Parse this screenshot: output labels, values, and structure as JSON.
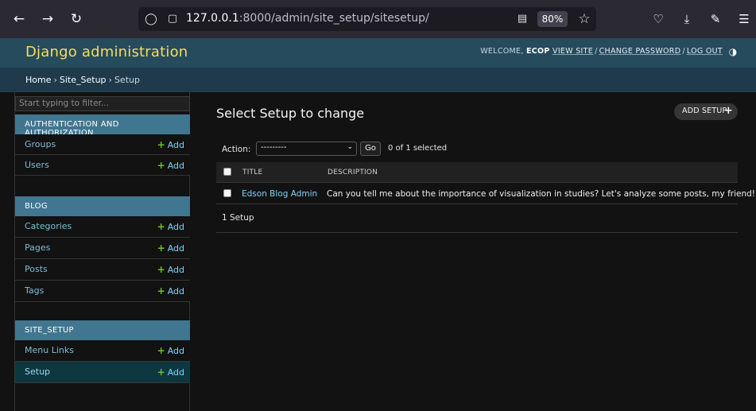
{
  "browser": {
    "url_host": "127.0.0.1",
    "url_rest": ":8000/admin/site_setup/sitesetup/",
    "zoom": "80%"
  },
  "header": {
    "brand": "Django administration",
    "welcome": "Welcome,",
    "username": "ECOP",
    "view_site": "View site",
    "change_password": "Change password",
    "log_out": "Log out",
    "separator": "/"
  },
  "breadcrumbs": {
    "home": "Home",
    "app": "Site_Setup",
    "current": "Setup",
    "separator": "›"
  },
  "sidebar": {
    "filter_placeholder": "Start typing to filter...",
    "add_label": "Add",
    "add_symbol": "+",
    "modules": [
      {
        "caption": "Authentication and Authorization",
        "models": [
          "Groups",
          "Users"
        ]
      },
      {
        "caption": "Blog",
        "models": [
          "Categories",
          "Pages",
          "Posts",
          "Tags"
        ]
      },
      {
        "caption": "Site_Setup",
        "models": [
          "Menu Links",
          "Setup"
        ]
      }
    ]
  },
  "main": {
    "title": "Select Setup to change",
    "add_button": "Add Setup",
    "action_label": "Action:",
    "action_select": "---------",
    "go_label": "Go",
    "selected_counter": "0 of 1 selected",
    "columns": {
      "title": "Title",
      "description": "Description"
    },
    "rows": [
      {
        "title": "Edson Blog Admin",
        "description": "Can you tell me about the importance of visualization in studies? Let's analyze some posts, my friend!"
      }
    ],
    "result_count": "1 Setup"
  },
  "colors": {
    "header_bg": "#264b5d",
    "brand": "#f5dd5d",
    "breadcrumbs_bg": "#1f3b4b",
    "module_caption": "#417690",
    "link": "#81d4fa",
    "add_plus": "#70bf2b",
    "current_row": "#0d3840"
  }
}
